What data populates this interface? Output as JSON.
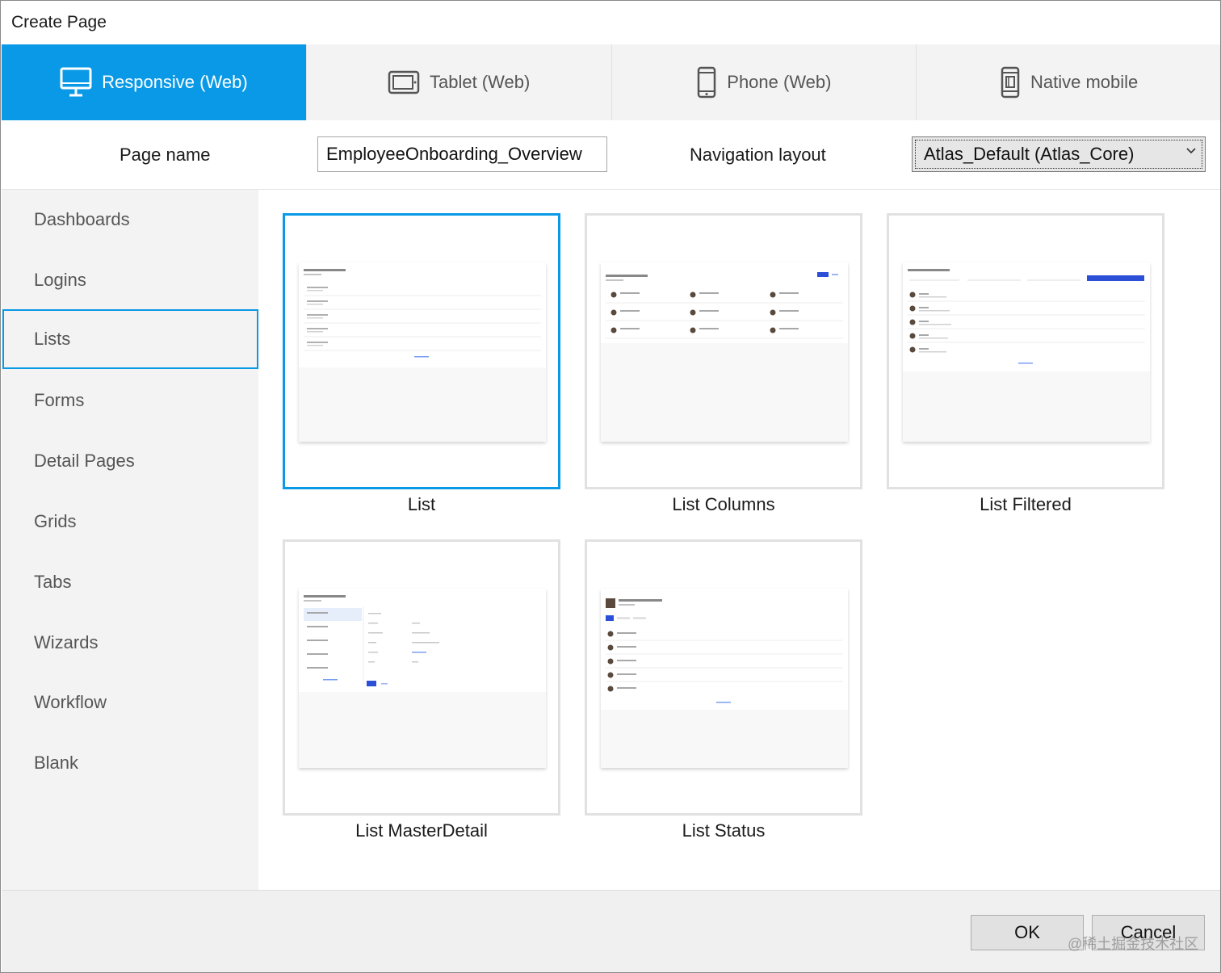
{
  "window": {
    "title": "Create Page"
  },
  "tabs": [
    {
      "label": "Responsive (Web)",
      "icon": "monitor-icon",
      "active": true
    },
    {
      "label": "Tablet (Web)",
      "icon": "tablet-icon",
      "active": false
    },
    {
      "label": "Phone (Web)",
      "icon": "phone-icon",
      "active": false
    },
    {
      "label": "Native mobile",
      "icon": "native-mobile-icon",
      "active": false
    }
  ],
  "form": {
    "page_name_label": "Page name",
    "page_name_value": "EmployeeOnboarding_Overview",
    "navigation_layout_label": "Navigation layout",
    "navigation_layout_value": "Atlas_Default (Atlas_Core)"
  },
  "sidebar": {
    "items": [
      {
        "label": "Dashboards"
      },
      {
        "label": "Logins"
      },
      {
        "label": "Lists",
        "selected": true
      },
      {
        "label": "Forms"
      },
      {
        "label": "Detail Pages"
      },
      {
        "label": "Grids"
      },
      {
        "label": "Tabs"
      },
      {
        "label": "Wizards"
      },
      {
        "label": "Workflow"
      },
      {
        "label": "Blank"
      }
    ]
  },
  "templates": [
    {
      "label": "List",
      "selected": true
    },
    {
      "label": "List Columns"
    },
    {
      "label": "List Filtered"
    },
    {
      "label": "List MasterDetail"
    },
    {
      "label": "List Status"
    }
  ],
  "footer": {
    "ok_label": "OK",
    "cancel_label": "Cancel",
    "watermark": "@稀土掘金技术社区"
  },
  "colors": {
    "accent": "#0a99e6",
    "preview_button": "#2c4fd8"
  }
}
